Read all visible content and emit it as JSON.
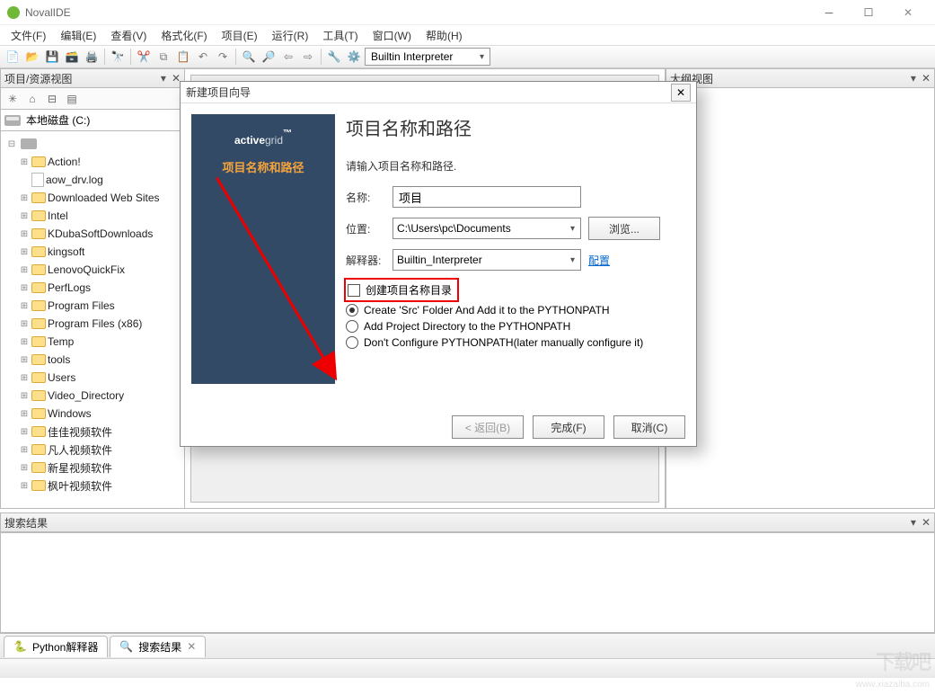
{
  "app": {
    "title": "NovalIDE"
  },
  "menus": [
    "文件(F)",
    "编辑(E)",
    "查看(V)",
    "格式化(F)",
    "项目(E)",
    "运行(R)",
    "工具(T)",
    "窗口(W)",
    "帮助(H)"
  ],
  "toolbar": {
    "interpreter": "Builtin Interpreter"
  },
  "project_pane": {
    "title": "项目/资源视图",
    "drive": "本地磁盘 (C:)",
    "nodes": [
      {
        "label": "Action!",
        "type": "folder",
        "exp": "plus"
      },
      {
        "label": "aow_drv.log",
        "type": "file",
        "exp": "none"
      },
      {
        "label": "Downloaded Web Sites",
        "type": "folder",
        "exp": "plus"
      },
      {
        "label": "Intel",
        "type": "folder",
        "exp": "plus"
      },
      {
        "label": "KDubaSoftDownloads",
        "type": "folder",
        "exp": "plus"
      },
      {
        "label": "kingsoft",
        "type": "folder",
        "exp": "plus"
      },
      {
        "label": "LenovoQuickFix",
        "type": "folder",
        "exp": "plus"
      },
      {
        "label": "PerfLogs",
        "type": "folder",
        "exp": "plus"
      },
      {
        "label": "Program Files",
        "type": "folder",
        "exp": "plus"
      },
      {
        "label": "Program Files (x86)",
        "type": "folder",
        "exp": "plus"
      },
      {
        "label": "Temp",
        "type": "folder",
        "exp": "plus"
      },
      {
        "label": "tools",
        "type": "folder",
        "exp": "plus"
      },
      {
        "label": "Users",
        "type": "folder",
        "exp": "plus"
      },
      {
        "label": "Video_Directory",
        "type": "folder",
        "exp": "plus"
      },
      {
        "label": "Windows",
        "type": "folder",
        "exp": "plus"
      },
      {
        "label": "佳佳视频软件",
        "type": "folder",
        "exp": "plus"
      },
      {
        "label": "凡人视频软件",
        "type": "folder",
        "exp": "plus"
      },
      {
        "label": "新星视频软件",
        "type": "folder",
        "exp": "plus"
      },
      {
        "label": "枫叶视频软件",
        "type": "folder",
        "exp": "plus"
      }
    ]
  },
  "right_panel": {
    "title": "大纲视图"
  },
  "search": {
    "title": "搜索结果"
  },
  "tabs": [
    {
      "label": "Python解释器"
    },
    {
      "label": "搜索结果"
    }
  ],
  "wizard": {
    "title": "新建项目向导",
    "brand_a": "active",
    "brand_b": "grid",
    "tm": "™",
    "sub": "项目名称和路径",
    "heading": "项目名称和路径",
    "hint": "请输入项目名称和路径.",
    "name_label": "名称:",
    "name_value": "项目",
    "loc_label": "位置:",
    "loc_value": "C:\\Users\\pc\\Documents",
    "browse": "浏览...",
    "interp_label": "解释器:",
    "interp_value": "Builtin_Interpreter",
    "config": "配置",
    "chk": "创建项目名称目录",
    "r1": "Create 'Src' Folder And Add it to the PYTHONPATH",
    "r2": "Add Project Directory to the PYTHONPATH",
    "r3": "Don't Configure PYTHONPATH(later manually configure it)",
    "back": "< 返回(B)",
    "finish": "完成(F)",
    "cancel": "取消(C)"
  }
}
